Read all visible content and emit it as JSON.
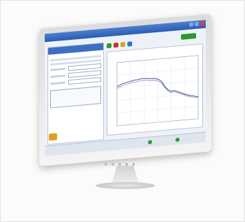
{
  "app": {
    "window_title": "",
    "brand_badge": "",
    "left_panel_title": "",
    "chart_title": ""
  },
  "chart_data": {
    "type": "line",
    "title": "",
    "xlabel": "",
    "ylabel": "",
    "series": [
      {
        "values": [
          0.62,
          0.64,
          0.66,
          0.67,
          0.68,
          0.69,
          0.7,
          0.7,
          0.71,
          0.71,
          0.71,
          0.7,
          0.7,
          0.69,
          0.67,
          0.63,
          0.55,
          0.5,
          0.47,
          0.48,
          0.46,
          0.44,
          0.42,
          0.4,
          0.38,
          0.37,
          0.36,
          0.35
        ]
      },
      {
        "values": [
          0.59,
          0.61,
          0.63,
          0.64,
          0.65,
          0.66,
          0.67,
          0.67,
          0.68,
          0.68,
          0.68,
          0.67,
          0.67,
          0.66,
          0.64,
          0.6,
          0.53,
          0.48,
          0.45,
          0.46,
          0.44,
          0.42,
          0.4,
          0.38,
          0.36,
          0.35,
          0.34,
          0.33
        ]
      }
    ],
    "colors": [
      "#2f3a8f",
      "#8f9ac8"
    ],
    "grid": true
  },
  "colors": {
    "titlebar": "#2c5bb2",
    "accent_green": "#2e9a3c",
    "accent_red": "#c93030"
  },
  "icons": [
    "back-icon",
    "close-icon",
    "refresh-icon",
    "chart-icon"
  ]
}
